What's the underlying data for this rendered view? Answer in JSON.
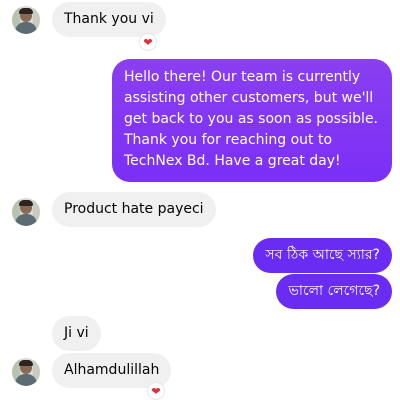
{
  "messages": [
    {
      "text": "Thank you vi"
    },
    {
      "text": "Hello there! Our team is currently assisting other customers, but we'll get back to you as soon as possible. Thank you for reaching out to TechNex Bd. Have a great day!"
    },
    {
      "text": "Product hate payeci"
    },
    {
      "text": "সব ঠিক আছে স্যার?"
    },
    {
      "text": "ভালো লেগেছে?"
    },
    {
      "text": "Ji vi"
    },
    {
      "text": "Alhamdulillah"
    }
  ],
  "reactions": {
    "heart_1": "❤",
    "heart_2": "❤"
  },
  "icons": {
    "avatar": "contact-avatar",
    "reaction": "heart-reaction-icon"
  },
  "colors": {
    "incoming_bubble": "#f0f0f0",
    "outgoing_bubble": "#7b2ff7",
    "reaction_heart": "#e02f3a"
  }
}
